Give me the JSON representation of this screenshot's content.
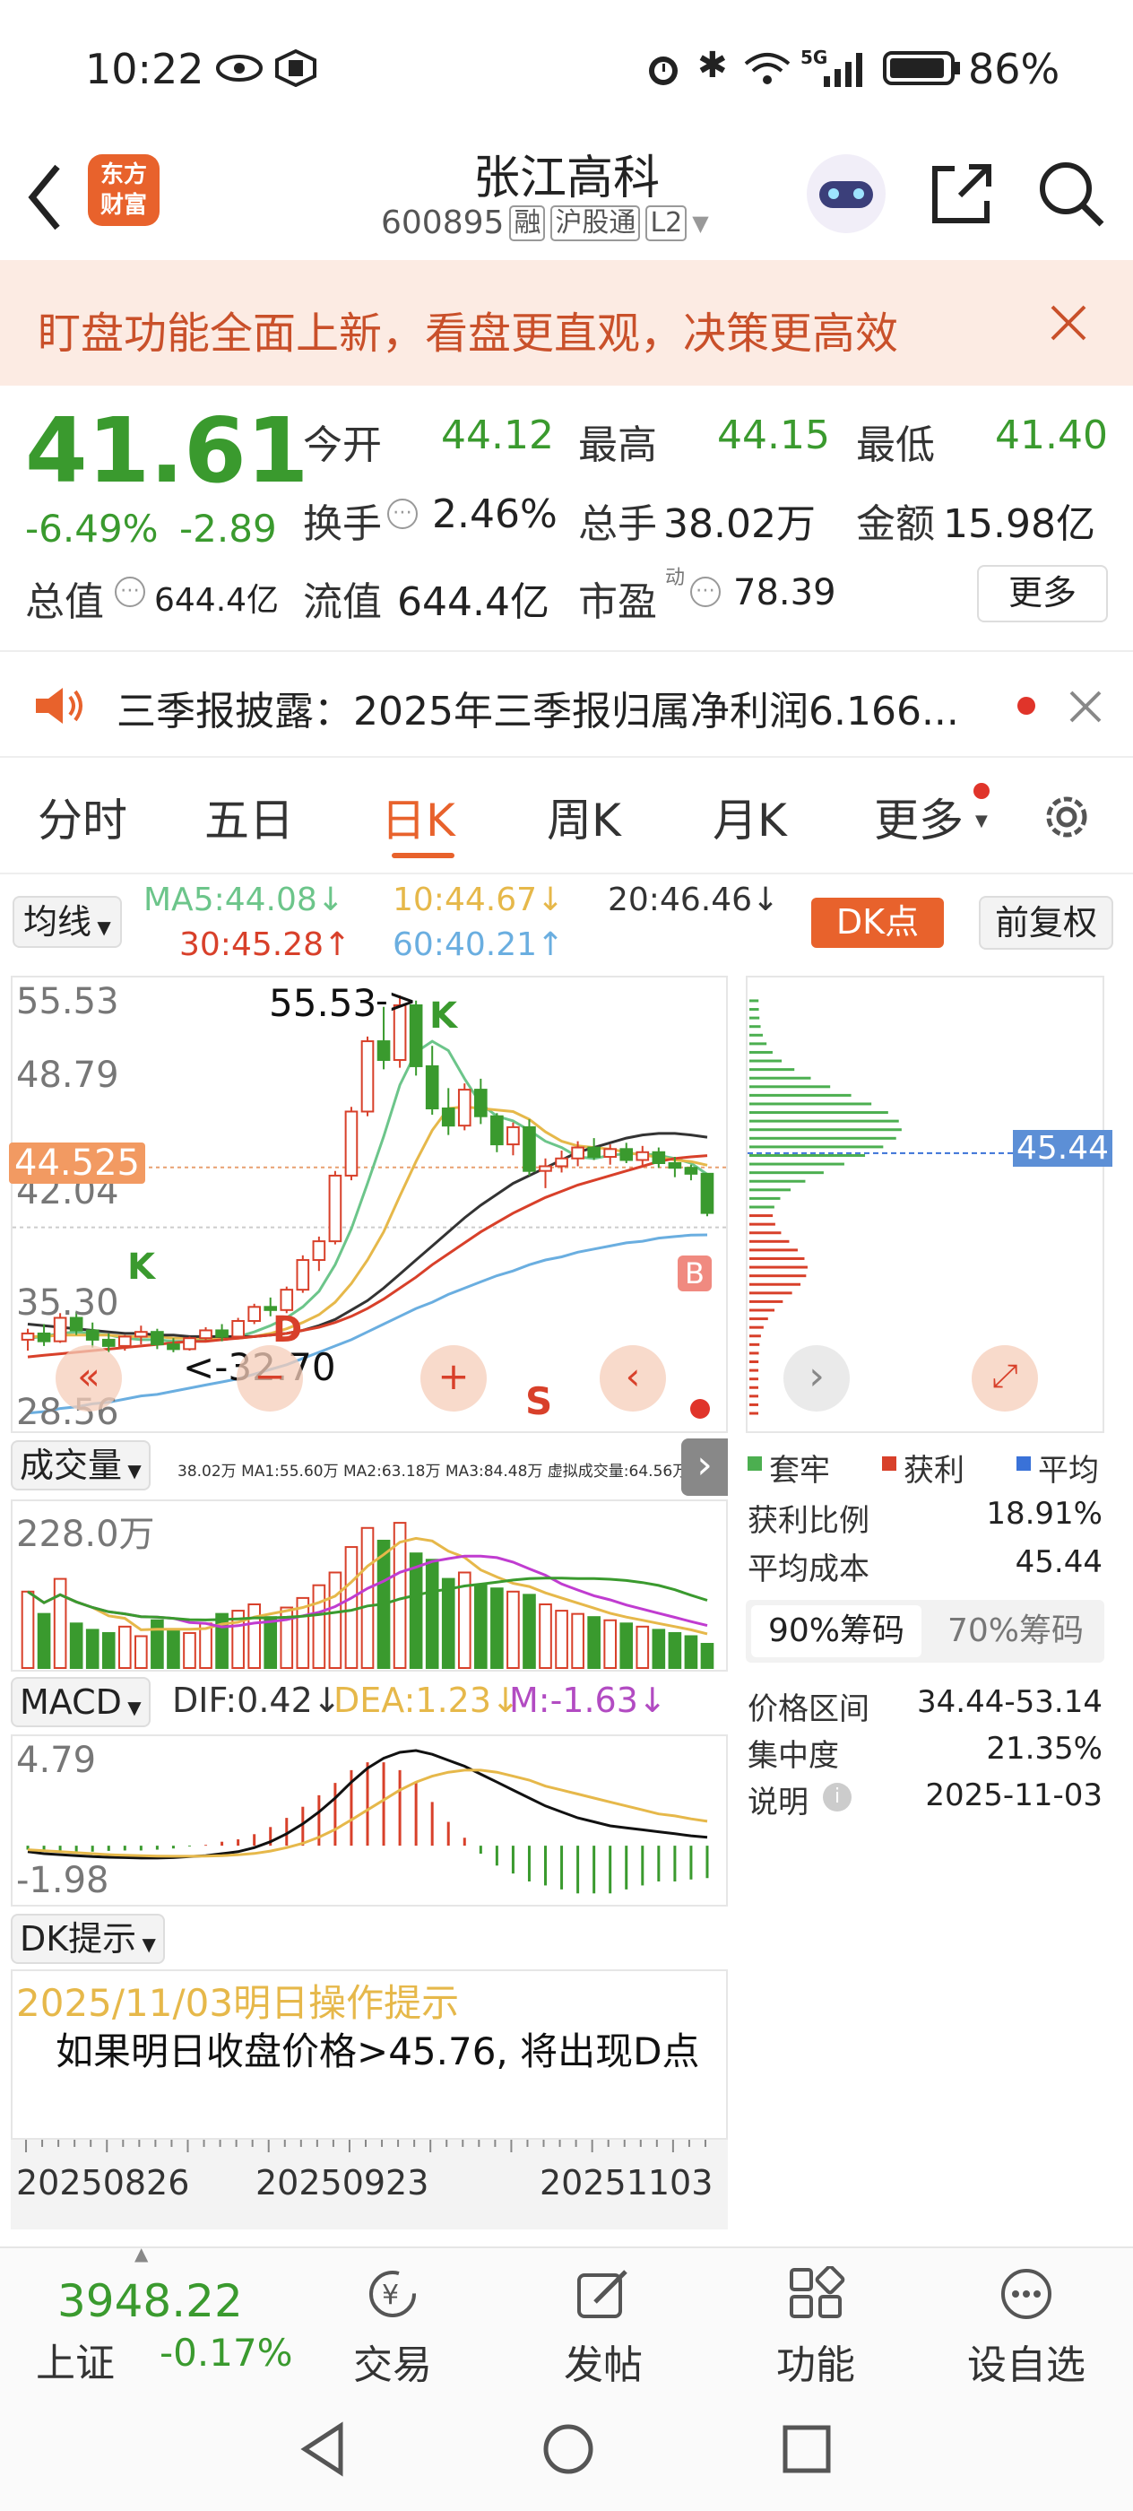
{
  "status": {
    "time": "10:22",
    "signal": "5G",
    "battery": "86%"
  },
  "header": {
    "title": "张江高科",
    "code": "600895",
    "tags": [
      "融",
      "沪股通",
      "L2"
    ],
    "logo": [
      "东方",
      "财富"
    ]
  },
  "banner": {
    "text": "盯盘功能全面上新，看盘更直观，决策更高效"
  },
  "quote": {
    "price": "41.61",
    "pct": "-6.49%",
    "chg": "-2.89",
    "labels": {
      "open": "今开",
      "high": "最高",
      "low": "最低",
      "turnover": "换手",
      "volume": "总手",
      "amount": "金额",
      "mcap": "总值",
      "float": "流值",
      "pe": "市盈",
      "pe_sup": "动",
      "more": "更多"
    },
    "open": "44.12",
    "high": "44.15",
    "low": "41.40",
    "turnover": "2.46%",
    "volume": "38.02万",
    "amount": "15.98亿",
    "mcap": "644.4亿",
    "float": "644.4亿",
    "pe": "78.39"
  },
  "notice": {
    "text": "三季报披露：2025年三季报归属净利润6.166..."
  },
  "tabs": [
    "分时",
    "五日",
    "日K",
    "周K",
    "月K",
    "更多"
  ],
  "active_tab": 2,
  "ma": {
    "selector": "均线",
    "ma5": "MA5:44.08↓",
    "ma10": "10:44.67↓",
    "ma20": "20:46.46↓",
    "ma30": "30:45.28↑",
    "ma60": "60:40.21↑",
    "dk": "DK点",
    "adjust": "前复权"
  },
  "kchart": {
    "y_labels": [
      "55.53",
      "48.79",
      "42.04",
      "35.30",
      "28.56"
    ],
    "current": "44.525",
    "high_mark": "55.53",
    "low_mark": "<-32.70",
    "k_marks": [
      "K",
      "K",
      "D",
      "S",
      "B"
    ],
    "cost_label": "45.44"
  },
  "colors": {
    "up": "#d8402a",
    "down": "#3a9a2e",
    "ma5": "#6cc58a",
    "ma10": "#e6b84a",
    "ma20": "#333333",
    "ma30": "#d8402a",
    "ma60": "#6aaee0",
    "accent": "#e8622c"
  },
  "volume": {
    "selector": "成交量",
    "legend": "38.02万 MA1:55.60万 MA2:63.18万 MA3:84.48万 虚拟成交量:64.56万",
    "max": "228.0万"
  },
  "macd": {
    "selector": "MACD",
    "dif": "DIF:0.42↓",
    "dea": "DEA:1.23↓",
    "m": "M:-1.63↓",
    "top": "4.79",
    "bottom": "-1.98"
  },
  "dk": {
    "selector": "DK提示",
    "date_line": "2025/11/03明日操作提示",
    "tip": "如果明日收盘价格>45.76, 将出现D点"
  },
  "dates": [
    "20250826",
    "20250923",
    "20251103"
  ],
  "chip": {
    "legend": [
      "套牢",
      "获利",
      "平均"
    ],
    "profit_ratio_label": "获利比例",
    "profit_ratio": "18.91%",
    "avg_cost_label": "平均成本",
    "avg_cost": "45.44",
    "tabs": [
      "90%筹码",
      "70%筹码"
    ],
    "range_label": "价格区间",
    "range": "34.44-53.14",
    "conc_label": "集中度",
    "conc": "21.35%",
    "note_label": "说明",
    "note": "2025-11-03"
  },
  "bottom": {
    "index_value": "3948.22",
    "index_name": "上证",
    "index_pct": "-0.17%",
    "items": [
      "交易",
      "发帖",
      "功能",
      "设自选"
    ]
  },
  "chart_data": {
    "type": "candlestick",
    "ylim": [
      28.56,
      55.53
    ],
    "x_ticks": [
      "20250826",
      "20250923",
      "20251103"
    ],
    "candles": [
      [
        33.5,
        34.2,
        32.8,
        33.9
      ],
      [
        33.9,
        34.5,
        33.1,
        33.4
      ],
      [
        33.4,
        35.2,
        33.3,
        34.9
      ],
      [
        34.9,
        35.3,
        33.8,
        34.1
      ],
      [
        34.1,
        34.6,
        33.0,
        33.5
      ],
      [
        33.5,
        33.9,
        32.7,
        33.1
      ],
      [
        33.1,
        33.8,
        32.8,
        33.7
      ],
      [
        33.7,
        34.4,
        33.2,
        34.0
      ],
      [
        34.0,
        34.2,
        32.9,
        33.2
      ],
      [
        33.2,
        33.6,
        32.7,
        32.9
      ],
      [
        32.9,
        33.7,
        32.8,
        33.6
      ],
      [
        33.6,
        34.3,
        33.4,
        34.1
      ],
      [
        34.1,
        34.5,
        33.4,
        33.7
      ],
      [
        33.7,
        34.9,
        33.6,
        34.7
      ],
      [
        34.7,
        35.8,
        34.5,
        35.6
      ],
      [
        35.6,
        36.2,
        35.0,
        35.4
      ],
      [
        35.4,
        36.9,
        35.2,
        36.7
      ],
      [
        36.7,
        38.9,
        36.5,
        38.6
      ],
      [
        38.6,
        40.1,
        37.9,
        39.8
      ],
      [
        39.8,
        44.3,
        39.6,
        44.0
      ],
      [
        44.0,
        48.4,
        43.7,
        48.1
      ],
      [
        48.1,
        52.9,
        47.8,
        52.6
      ],
      [
        52.6,
        54.8,
        50.8,
        51.4
      ],
      [
        51.4,
        55.53,
        50.9,
        54.9
      ],
      [
        54.9,
        55.2,
        50.4,
        51.0
      ],
      [
        51.0,
        52.3,
        47.9,
        48.3
      ],
      [
        48.3,
        49.6,
        46.6,
        47.2
      ],
      [
        47.2,
        49.9,
        46.9,
        49.5
      ],
      [
        49.5,
        50.2,
        47.3,
        47.8
      ],
      [
        47.8,
        48.0,
        45.5,
        46.0
      ],
      [
        46.0,
        47.4,
        45.3,
        47.1
      ],
      [
        47.1,
        47.6,
        44.0,
        44.3
      ],
      [
        44.3,
        45.1,
        43.2,
        44.6
      ],
      [
        44.6,
        45.6,
        44.2,
        45.1
      ],
      [
        45.1,
        46.2,
        44.6,
        45.8
      ],
      [
        45.8,
        46.4,
        45.0,
        45.2
      ],
      [
        45.2,
        46.0,
        44.7,
        45.7
      ],
      [
        45.7,
        46.1,
        44.8,
        45.0
      ],
      [
        45.0,
        45.9,
        44.6,
        45.5
      ],
      [
        45.5,
        45.8,
        44.5,
        44.8
      ],
      [
        44.8,
        45.2,
        43.9,
        44.5
      ],
      [
        44.5,
        44.7,
        43.7,
        44.12
      ],
      [
        44.12,
        44.15,
        41.4,
        41.61
      ]
    ],
    "series": [
      {
        "name": "MA5",
        "values": [
          33.6,
          33.7,
          33.9,
          34.0,
          33.9,
          33.8,
          33.6,
          33.5,
          33.5,
          33.4,
          33.4,
          33.5,
          33.6,
          33.7,
          34.0,
          34.4,
          34.9,
          35.6,
          36.6,
          38.3,
          40.6,
          43.5,
          46.5,
          49.8,
          51.9,
          52.6,
          52.0,
          50.2,
          48.6,
          47.8,
          47.5,
          46.9,
          46.2,
          45.8,
          45.2,
          45.1,
          45.3,
          45.4,
          45.4,
          45.3,
          45.1,
          44.8,
          44.08
        ]
      },
      {
        "name": "10",
        "values": [
          33.7,
          33.7,
          33.8,
          33.8,
          33.8,
          33.8,
          33.7,
          33.7,
          33.7,
          33.6,
          33.6,
          33.6,
          33.6,
          33.6,
          33.7,
          33.9,
          34.2,
          34.6,
          35.1,
          35.9,
          37.1,
          38.6,
          40.4,
          42.7,
          44.9,
          46.9,
          48.3,
          48.4,
          48.3,
          48.2,
          48.1,
          47.6,
          46.8,
          46.2,
          45.9,
          45.8,
          45.7,
          45.5,
          45.3,
          45.2,
          45.0,
          44.9,
          44.67
        ]
      },
      {
        "name": "20",
        "values": [
          34.5,
          34.4,
          34.3,
          34.2,
          34.1,
          34.0,
          33.9,
          33.9,
          33.8,
          33.8,
          33.7,
          33.7,
          33.7,
          33.7,
          33.7,
          33.8,
          33.9,
          34.1,
          34.4,
          34.8,
          35.4,
          36.0,
          36.8,
          37.7,
          38.6,
          39.5,
          40.4,
          41.3,
          42.1,
          42.8,
          43.5,
          44.0,
          44.5,
          45.0,
          45.5,
          45.8,
          46.1,
          46.4,
          46.6,
          46.7,
          46.7,
          46.6,
          46.46
        ]
      },
      {
        "name": "30",
        "values": [
          32.4,
          32.5,
          32.6,
          32.7,
          32.8,
          32.9,
          33.0,
          33.1,
          33.2,
          33.3,
          33.4,
          33.4,
          33.5,
          33.6,
          33.7,
          33.8,
          33.9,
          34.1,
          34.3,
          34.6,
          35.0,
          35.5,
          36.1,
          36.8,
          37.5,
          38.3,
          39.0,
          39.7,
          40.4,
          41.0,
          41.6,
          42.1,
          42.6,
          43.0,
          43.4,
          43.7,
          44.0,
          44.3,
          44.6,
          44.9,
          45.1,
          45.2,
          45.28
        ]
      },
      {
        "name": "60",
        "values": [
          28.8,
          28.9,
          29.1,
          29.2,
          29.4,
          29.5,
          29.7,
          29.9,
          30.0,
          30.2,
          30.4,
          30.6,
          30.8,
          31.0,
          31.3,
          31.6,
          31.9,
          32.3,
          32.7,
          33.1,
          33.5,
          34.0,
          34.5,
          35.0,
          35.5,
          35.9,
          36.4,
          36.8,
          37.2,
          37.6,
          37.9,
          38.3,
          38.6,
          38.8,
          39.1,
          39.3,
          39.5,
          39.7,
          39.8,
          40.0,
          40.1,
          40.2,
          40.21
        ]
      }
    ],
    "volume": [
      120,
      85,
      140,
      70,
      60,
      55,
      65,
      50,
      75,
      60,
      55,
      70,
      85,
      90,
      100,
      80,
      95,
      110,
      130,
      150,
      190,
      220,
      200,
      228,
      180,
      170,
      140,
      150,
      130,
      125,
      120,
      115,
      100,
      90,
      85,
      80,
      75,
      70,
      65,
      60,
      55,
      50,
      38
    ],
    "macd": {
      "dif": [
        -0.3,
        -0.4,
        -0.45,
        -0.5,
        -0.55,
        -0.58,
        -0.6,
        -0.62,
        -0.62,
        -0.6,
        -0.55,
        -0.5,
        -0.4,
        -0.3,
        -0.1,
        0.2,
        0.6,
        1.1,
        1.7,
        2.4,
        3.2,
        3.9,
        4.4,
        4.7,
        4.79,
        4.6,
        4.3,
        4.0,
        3.6,
        3.2,
        2.8,
        2.4,
        2.0,
        1.7,
        1.4,
        1.2,
        1.0,
        0.9,
        0.8,
        0.7,
        0.6,
        0.5,
        0.42
      ],
      "dea": [
        -0.2,
        -0.25,
        -0.3,
        -0.35,
        -0.4,
        -0.45,
        -0.48,
        -0.5,
        -0.52,
        -0.53,
        -0.53,
        -0.52,
        -0.5,
        -0.46,
        -0.39,
        -0.27,
        -0.1,
        0.12,
        0.43,
        0.82,
        1.3,
        1.8,
        2.3,
        2.8,
        3.2,
        3.5,
        3.7,
        3.8,
        3.8,
        3.7,
        3.5,
        3.3,
        3.0,
        2.8,
        2.6,
        2.4,
        2.2,
        2.0,
        1.8,
        1.6,
        1.5,
        1.35,
        1.23
      ],
      "m": [
        -0.2,
        -0.3,
        -0.3,
        -0.3,
        -0.3,
        -0.26,
        -0.24,
        -0.24,
        -0.2,
        -0.14,
        -0.04,
        0.04,
        0.2,
        0.32,
        0.58,
        0.94,
        1.4,
        1.96,
        2.54,
        3.16,
        3.8,
        4.2,
        4.2,
        3.8,
        3.18,
        2.2,
        1.2,
        0.4,
        -0.4,
        -1.0,
        -1.4,
        -1.8,
        -2.0,
        -2.2,
        -2.4,
        -2.4,
        -2.4,
        -2.2,
        -2.0,
        -1.8,
        -1.8,
        -1.7,
        -1.63
      ]
    }
  }
}
